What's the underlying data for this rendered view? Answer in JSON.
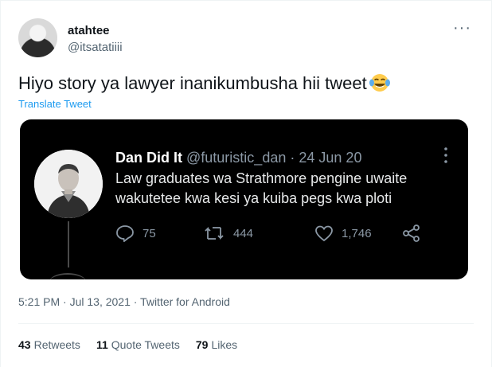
{
  "author": {
    "name": "atahtee",
    "handle": "@itsatatiiii"
  },
  "tweet": {
    "text": "Hiyo story ya lawyer inanikumbusha hii tweet",
    "emoji": "face-with-tears-of-joy",
    "translate_label": "Translate Tweet"
  },
  "embedded": {
    "name": "Dan Did It",
    "handle": "@futuristic_dan",
    "separator": "·",
    "date": "24 Jun 20",
    "text": "Law graduates wa Strathmore pengine uwaite wakutetee kwa kesi ya kuiba pegs kwa ploti",
    "replies": "75",
    "retweets": "444",
    "likes": "1,746"
  },
  "meta": {
    "text": "5:21 PM · Jul 13, 2021 · Twitter for Android"
  },
  "stats": {
    "retweets_count": "43",
    "retweets_label": "Retweets",
    "quotes_count": "11",
    "quotes_label": "Quote Tweets",
    "likes_count": "79",
    "likes_label": "Likes"
  },
  "colors": {
    "link": "#1d9bf0",
    "secondary": "#536471",
    "embed_bg": "#000000"
  }
}
